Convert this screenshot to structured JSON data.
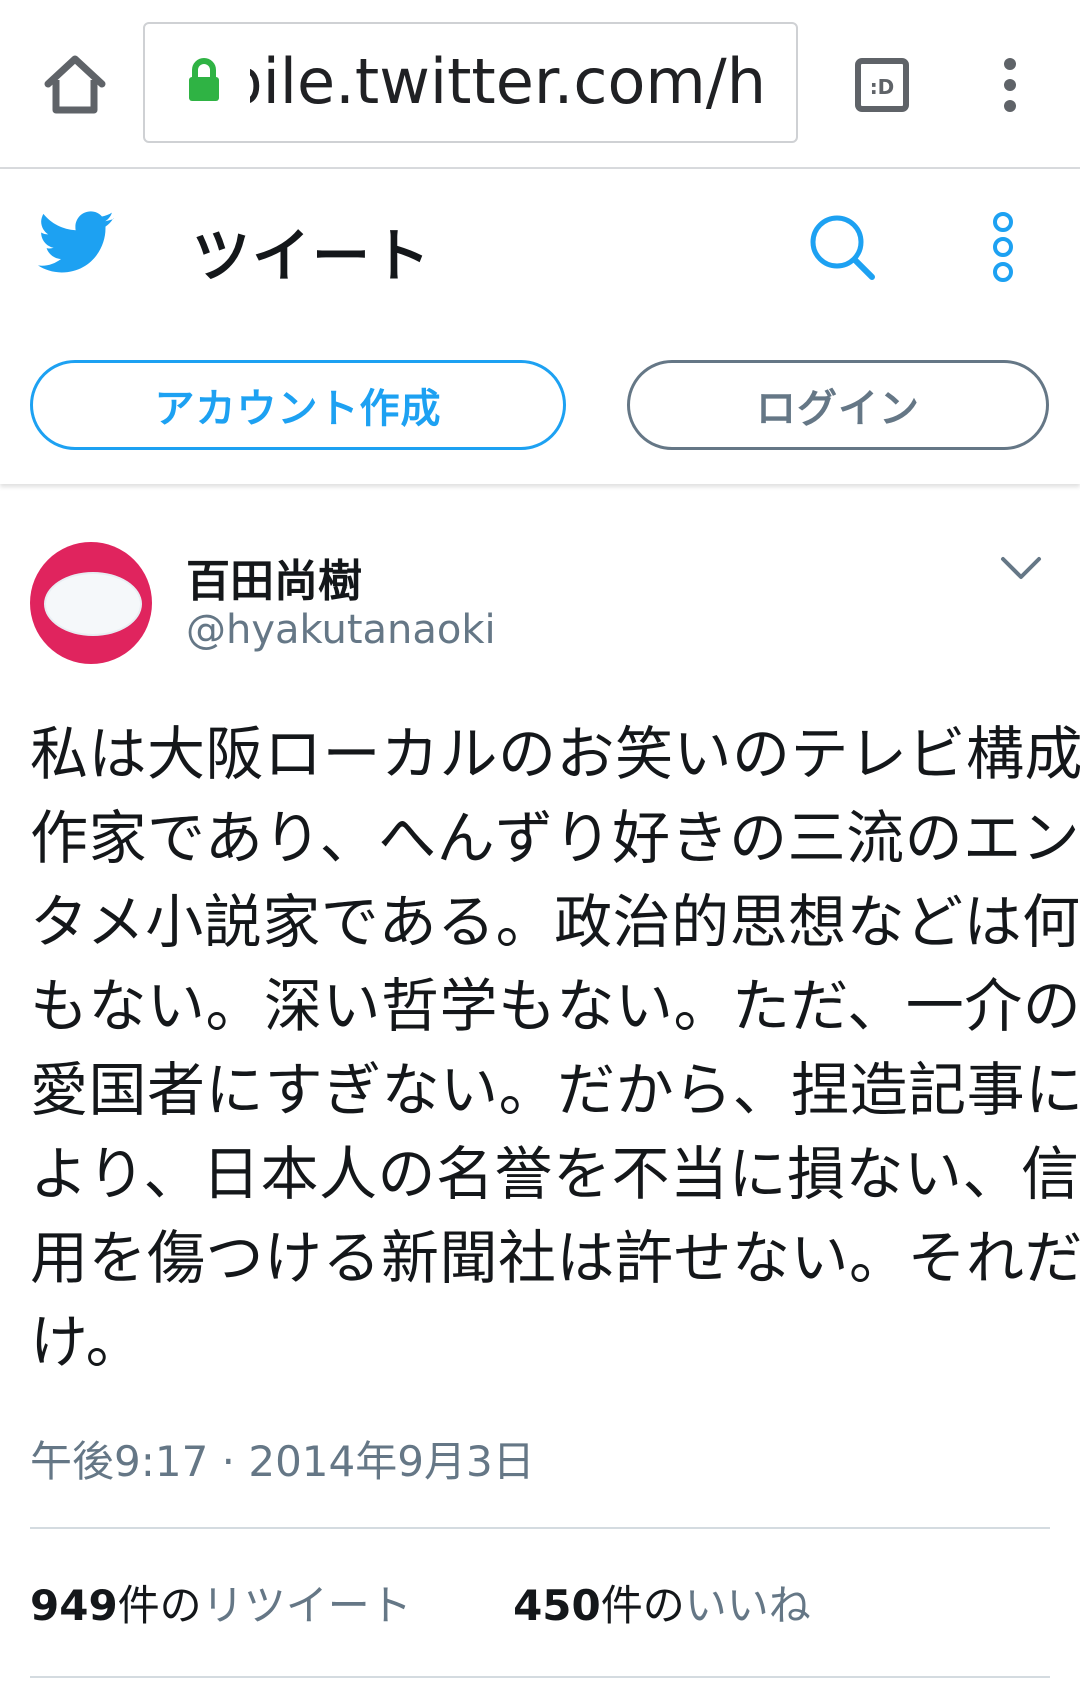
{
  "browser": {
    "url_display": "mobile.twitter.com/h",
    "tabs_icon_label": ":D",
    "colors": {
      "lock": "#2fb344"
    }
  },
  "header": {
    "title": "ツイート",
    "signup_label": "アカウント作成",
    "login_label": "ログイン",
    "colors": {
      "brand": "#1da1f2",
      "muted": "#657786"
    }
  },
  "tweet": {
    "display_name": "百田尚樹",
    "handle": "@hyakutanaoki",
    "text_lines": [
      "私は大阪ローカルのお笑いのテレビ構成",
      "作家であり、へんずり好きの三流のエン",
      "タメ小説家である。政治的思想などは何",
      "もない。深い哲学もない。ただ、一介の",
      "愛国者にすぎない。だから、捏造記事に",
      "より、日本人の名誉を不当に損ない、信",
      "用を傷つける新聞社は許せない。それだ",
      "け。"
    ],
    "timestamp": "午後9:17 · 2014年9月3日",
    "retweets": {
      "count": "949",
      "unit": "件の",
      "label": "リツイート"
    },
    "likes": {
      "count": "450",
      "unit": "件の",
      "label": "いいね"
    },
    "colors": {
      "avatar_bg": "#e0245e"
    }
  }
}
